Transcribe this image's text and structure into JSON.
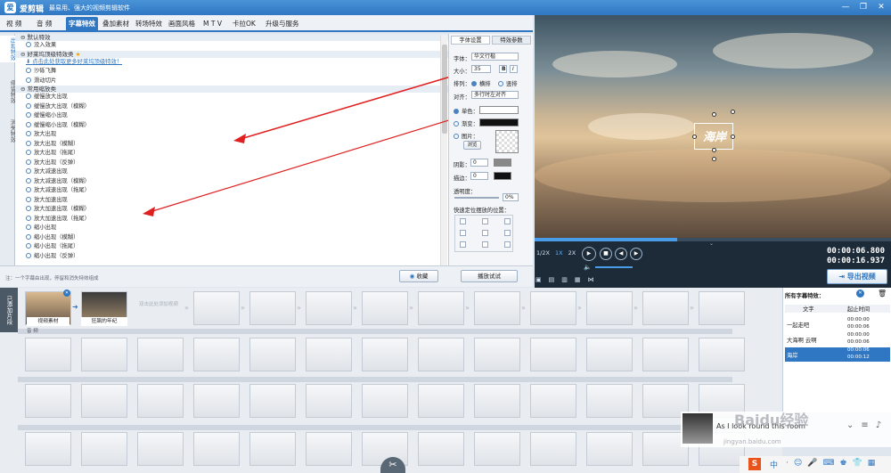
{
  "titlebar": {
    "logo": "爱",
    "title": "爱剪辑",
    "subtitle": "最易用、强大的视频剪辑软件"
  },
  "tabs": [
    {
      "label": "视 频"
    },
    {
      "label": "音 频"
    },
    {
      "label": "字幕特效"
    },
    {
      "label": "叠加素材"
    },
    {
      "label": "转场特效"
    },
    {
      "label": "画面风格"
    },
    {
      "label": "M T V"
    },
    {
      "label": "卡拉OK"
    },
    {
      "label": "升级与服务"
    }
  ],
  "sidenav": [
    {
      "label": "出现特效"
    },
    {
      "label": "停留特效"
    },
    {
      "label": "消失特效"
    }
  ],
  "effects": {
    "group_default": "默认特效",
    "opt_none": "没入效果",
    "group_hollywood": "好莱坞顶级特效类",
    "get_more_link": "点击此处获取更多好莱坞顶级特效！",
    "hollywood_items": [
      "沙砾飞舞",
      "滑动切片"
    ],
    "group_common": "常用缩放类",
    "common_items": [
      "缓慢放大出现",
      "缓慢放大出现（模糊）",
      "缓慢缩小出现",
      "缓慢缩小出现（模糊）",
      "放大出现",
      "放大出现（模糊）",
      "放大出现（拖尾）",
      "放大出现（反弹）",
      "放大减速出现",
      "放大减速出现（模糊）",
      "放大减速出现（拖尾）",
      "放大加速出现",
      "放大加速出现（模糊）",
      "放大加速出现（拖尾）",
      "缩小出现",
      "缩小出现（模糊）",
      "缩小出现（拖尾）",
      "缩小出现（反弹）"
    ]
  },
  "settings": {
    "tab_font": "字体设置",
    "tab_effect": "特效参数",
    "font_label": "字体：",
    "font_value": "华文行楷",
    "size_label": "大小：",
    "size_value": "35",
    "bold": "B",
    "italic": "I",
    "arrange_label": "排列：",
    "horizontal": "横排",
    "vertical": "竖排",
    "align_label": "对齐：",
    "align_value": "多行时左对齐",
    "single_color": "单色：",
    "gradient": "渐变：",
    "image": "图片：",
    "browse": "浏览",
    "shadow_label": "阴影：",
    "shadow_value": "0",
    "border_label": "描边：",
    "border_value": "0",
    "opacity_label": "透明度：",
    "opacity_value": "0%",
    "quick_pos_label": "快速定位摆放的位置："
  },
  "bottombar": {
    "note": "注：一个字幕由出现，停留和消失特效组成",
    "collect": "收藏",
    "play_test": "播放试试"
  },
  "preview": {
    "caption": "海岸"
  },
  "controls": {
    "speeds": [
      "1/2X",
      "1X",
      "2X"
    ],
    "time_current": "00:00:06.800",
    "time_total": "00:00:16.937",
    "export": "导出视频"
  },
  "timeline": {
    "side_label": "已添加片段",
    "clip1_label": "视频素材",
    "clip2_label": "狂飙的年纪",
    "add_hint": "双击此处添加视频",
    "audio_label": "音 频"
  },
  "rightpanel": {
    "title": "所有字幕特效：",
    "col_text": "文字",
    "col_time": "起止时间",
    "rows": [
      {
        "text": "一起走吧",
        "start": "00:00:00",
        "end": "00:00:06"
      },
      {
        "text": "大海啊 云啊",
        "start": "00:00:00",
        "end": "00:00:06"
      },
      {
        "text": "海岸",
        "start": "00:00:06",
        "end": "00:00:12"
      }
    ]
  },
  "overlay": {
    "text": "As I look round this room",
    "watermark": "Baidu经验",
    "url": "jingyan.baidu.com"
  },
  "taskbar": {
    "lang": "中"
  }
}
